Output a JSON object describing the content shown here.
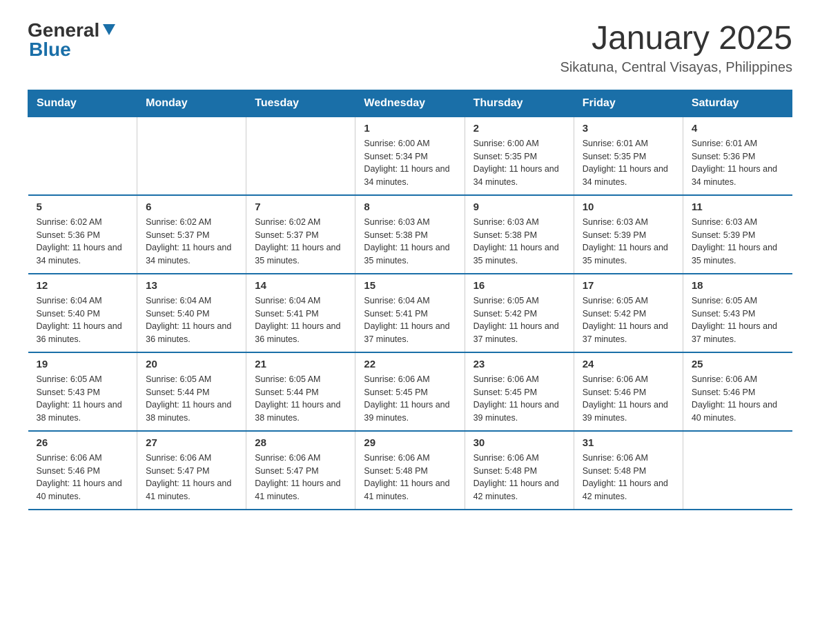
{
  "header": {
    "logo_general": "General",
    "logo_blue": "Blue",
    "month_year": "January 2025",
    "location": "Sikatuna, Central Visayas, Philippines"
  },
  "days_of_week": [
    "Sunday",
    "Monday",
    "Tuesday",
    "Wednesday",
    "Thursday",
    "Friday",
    "Saturday"
  ],
  "weeks": [
    [
      {
        "day": "",
        "info": ""
      },
      {
        "day": "",
        "info": ""
      },
      {
        "day": "",
        "info": ""
      },
      {
        "day": "1",
        "info": "Sunrise: 6:00 AM\nSunset: 5:34 PM\nDaylight: 11 hours and 34 minutes."
      },
      {
        "day": "2",
        "info": "Sunrise: 6:00 AM\nSunset: 5:35 PM\nDaylight: 11 hours and 34 minutes."
      },
      {
        "day": "3",
        "info": "Sunrise: 6:01 AM\nSunset: 5:35 PM\nDaylight: 11 hours and 34 minutes."
      },
      {
        "day": "4",
        "info": "Sunrise: 6:01 AM\nSunset: 5:36 PM\nDaylight: 11 hours and 34 minutes."
      }
    ],
    [
      {
        "day": "5",
        "info": "Sunrise: 6:02 AM\nSunset: 5:36 PM\nDaylight: 11 hours and 34 minutes."
      },
      {
        "day": "6",
        "info": "Sunrise: 6:02 AM\nSunset: 5:37 PM\nDaylight: 11 hours and 34 minutes."
      },
      {
        "day": "7",
        "info": "Sunrise: 6:02 AM\nSunset: 5:37 PM\nDaylight: 11 hours and 35 minutes."
      },
      {
        "day": "8",
        "info": "Sunrise: 6:03 AM\nSunset: 5:38 PM\nDaylight: 11 hours and 35 minutes."
      },
      {
        "day": "9",
        "info": "Sunrise: 6:03 AM\nSunset: 5:38 PM\nDaylight: 11 hours and 35 minutes."
      },
      {
        "day": "10",
        "info": "Sunrise: 6:03 AM\nSunset: 5:39 PM\nDaylight: 11 hours and 35 minutes."
      },
      {
        "day": "11",
        "info": "Sunrise: 6:03 AM\nSunset: 5:39 PM\nDaylight: 11 hours and 35 minutes."
      }
    ],
    [
      {
        "day": "12",
        "info": "Sunrise: 6:04 AM\nSunset: 5:40 PM\nDaylight: 11 hours and 36 minutes."
      },
      {
        "day": "13",
        "info": "Sunrise: 6:04 AM\nSunset: 5:40 PM\nDaylight: 11 hours and 36 minutes."
      },
      {
        "day": "14",
        "info": "Sunrise: 6:04 AM\nSunset: 5:41 PM\nDaylight: 11 hours and 36 minutes."
      },
      {
        "day": "15",
        "info": "Sunrise: 6:04 AM\nSunset: 5:41 PM\nDaylight: 11 hours and 37 minutes."
      },
      {
        "day": "16",
        "info": "Sunrise: 6:05 AM\nSunset: 5:42 PM\nDaylight: 11 hours and 37 minutes."
      },
      {
        "day": "17",
        "info": "Sunrise: 6:05 AM\nSunset: 5:42 PM\nDaylight: 11 hours and 37 minutes."
      },
      {
        "day": "18",
        "info": "Sunrise: 6:05 AM\nSunset: 5:43 PM\nDaylight: 11 hours and 37 minutes."
      }
    ],
    [
      {
        "day": "19",
        "info": "Sunrise: 6:05 AM\nSunset: 5:43 PM\nDaylight: 11 hours and 38 minutes."
      },
      {
        "day": "20",
        "info": "Sunrise: 6:05 AM\nSunset: 5:44 PM\nDaylight: 11 hours and 38 minutes."
      },
      {
        "day": "21",
        "info": "Sunrise: 6:05 AM\nSunset: 5:44 PM\nDaylight: 11 hours and 38 minutes."
      },
      {
        "day": "22",
        "info": "Sunrise: 6:06 AM\nSunset: 5:45 PM\nDaylight: 11 hours and 39 minutes."
      },
      {
        "day": "23",
        "info": "Sunrise: 6:06 AM\nSunset: 5:45 PM\nDaylight: 11 hours and 39 minutes."
      },
      {
        "day": "24",
        "info": "Sunrise: 6:06 AM\nSunset: 5:46 PM\nDaylight: 11 hours and 39 minutes."
      },
      {
        "day": "25",
        "info": "Sunrise: 6:06 AM\nSunset: 5:46 PM\nDaylight: 11 hours and 40 minutes."
      }
    ],
    [
      {
        "day": "26",
        "info": "Sunrise: 6:06 AM\nSunset: 5:46 PM\nDaylight: 11 hours and 40 minutes."
      },
      {
        "day": "27",
        "info": "Sunrise: 6:06 AM\nSunset: 5:47 PM\nDaylight: 11 hours and 41 minutes."
      },
      {
        "day": "28",
        "info": "Sunrise: 6:06 AM\nSunset: 5:47 PM\nDaylight: 11 hours and 41 minutes."
      },
      {
        "day": "29",
        "info": "Sunrise: 6:06 AM\nSunset: 5:48 PM\nDaylight: 11 hours and 41 minutes."
      },
      {
        "day": "30",
        "info": "Sunrise: 6:06 AM\nSunset: 5:48 PM\nDaylight: 11 hours and 42 minutes."
      },
      {
        "day": "31",
        "info": "Sunrise: 6:06 AM\nSunset: 5:48 PM\nDaylight: 11 hours and 42 minutes."
      },
      {
        "day": "",
        "info": ""
      }
    ]
  ]
}
